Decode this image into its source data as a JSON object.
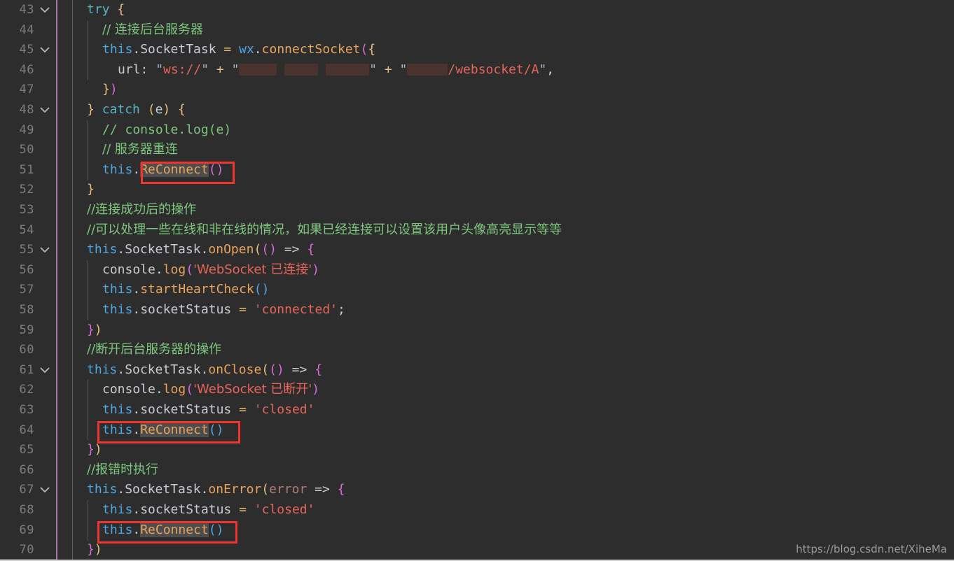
{
  "editor": {
    "background": "#2d2d2d",
    "gutter_divider_color": "#a878a8",
    "annotation_color": "#f0342e",
    "selection_color": "#4d4d4d",
    "first_line_number": 43,
    "last_line_number": 70,
    "fold_lines": [
      43,
      45,
      48,
      55,
      61,
      67
    ],
    "line_numbers": [
      "43",
      "44",
      "45",
      "46",
      "47",
      "48",
      "49",
      "50",
      "51",
      "52",
      "53",
      "54",
      "55",
      "56",
      "57",
      "58",
      "59",
      "60",
      "61",
      "62",
      "63",
      "64",
      "65",
      "66",
      "67",
      "68",
      "69",
      "70"
    ]
  },
  "code": {
    "lines": [
      {
        "n": "43",
        "text": "try {"
      },
      {
        "n": "44",
        "text": "// 连接后台服务器"
      },
      {
        "n": "45",
        "text": "this.SocketTask = wx.connectSocket({"
      },
      {
        "n": "46",
        "text": "url: \"ws://\" + \"[redacted]\" + \"[redacted]/websocket/A\","
      },
      {
        "n": "47",
        "text": "})"
      },
      {
        "n": "48",
        "text": "} catch (e) {"
      },
      {
        "n": "49",
        "text": "// console.log(e)"
      },
      {
        "n": "50",
        "text": "// 服务器重连"
      },
      {
        "n": "51",
        "text": "this.ReConnect()"
      },
      {
        "n": "52",
        "text": "}"
      },
      {
        "n": "53",
        "text": "//连接成功后的操作"
      },
      {
        "n": "54",
        "text": "//可以处理一些在线和非在线的情况，如果已经连接可以设置该用户头像高亮显示等等"
      },
      {
        "n": "55",
        "text": "this.SocketTask.onOpen(() => {"
      },
      {
        "n": "56",
        "text": "console.log('WebSocket 已连接')"
      },
      {
        "n": "57",
        "text": "this.startHeartCheck()"
      },
      {
        "n": "58",
        "text": "this.socketStatus = 'connected';"
      },
      {
        "n": "59",
        "text": "})"
      },
      {
        "n": "60",
        "text": "//断开后台服务器的操作"
      },
      {
        "n": "61",
        "text": "this.SocketTask.onClose(() => {"
      },
      {
        "n": "62",
        "text": "console.log('WebSocket 已断开')"
      },
      {
        "n": "63",
        "text": "this.socketStatus = 'closed'"
      },
      {
        "n": "64",
        "text": "this.ReConnect()"
      },
      {
        "n": "65",
        "text": "})"
      },
      {
        "n": "66",
        "text": "//报错时执行"
      },
      {
        "n": "67",
        "text": "this.SocketTask.onError(error => {"
      },
      {
        "n": "68",
        "text": "this.socketStatus = 'closed'"
      },
      {
        "n": "69",
        "text": "this.ReConnect()"
      },
      {
        "n": "70",
        "text": "})"
      }
    ],
    "tokens": {
      "kw_try": "try",
      "kw_catch": "catch",
      "this": "this",
      "wx": "wx",
      "socket_task": ".SocketTask",
      "connect_socket": "connectSocket",
      "url_key": "url",
      "ws_scheme": "ws://",
      "websocket_path": "/websocket/A",
      "reconnect": "ReConnect",
      "on_open": "onOpen",
      "on_close": "onClose",
      "on_error": "onError",
      "console": "console",
      "log": "log",
      "start_heart_check": "startHeartCheck",
      "socket_status": ".socketStatus",
      "error_param": "error",
      "catch_param": "e",
      "str_connected": "'connected'",
      "str_closed": "'closed'",
      "str_ws_open": "'WebSocket 已连接'",
      "str_ws_close": "'WebSocket 已断开'"
    },
    "comments": {
      "c44": "// 连接后台服务器",
      "c49": "// console.log(e)",
      "c50": "// 服务器重连",
      "c53": "//连接成功后的操作",
      "c54": "//可以处理一些在线和非在线的情况，如果已经连接可以设置该用户头像高亮显示等等",
      "c60": "//断开后台服务器的操作",
      "c66": "//报错时执行"
    }
  },
  "annotations": [
    {
      "label": "reconnect-highlight-line-51"
    },
    {
      "label": "reconnect-highlight-line-64"
    },
    {
      "label": "reconnect-highlight-line-69"
    }
  ],
  "watermark": {
    "text": "https://blog.csdn.net/XiheMa"
  }
}
